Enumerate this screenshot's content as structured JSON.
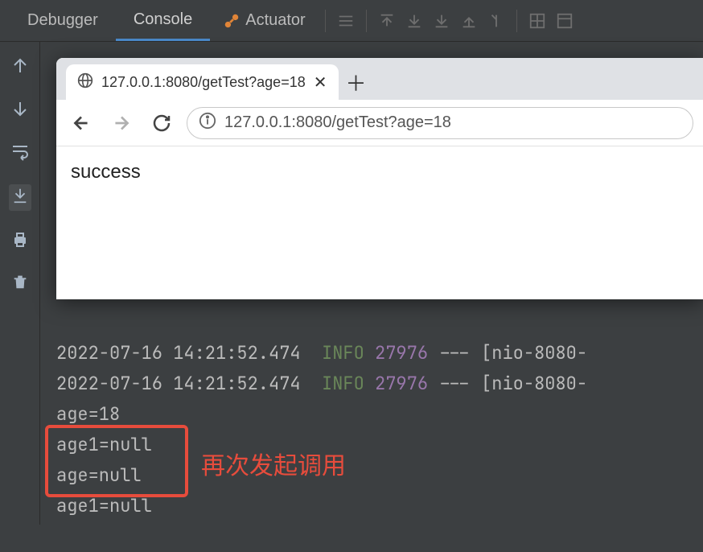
{
  "ideTabs": {
    "debugger": "Debugger",
    "console": "Console",
    "actuator": "Actuator"
  },
  "browser": {
    "tabTitle": "127.0.0.1:8080/getTest?age=18",
    "addressUrl": "127.0.0.1:8080/getTest?age=18",
    "pageContent": "success"
  },
  "console": {
    "lines": [
      {
        "time": "2022-07-16 14:21:52.474",
        "level": "INFO",
        "pid": "27976",
        "sep": "---",
        "thread": "[nio-8080-"
      },
      {
        "time": "2022-07-16 14:21:52.474",
        "level": "INFO",
        "pid": "27976",
        "sep": "---",
        "thread": "[nio-8080-"
      }
    ],
    "plain": [
      "age=18",
      "age1=null",
      "age=null",
      "age1=null"
    ]
  },
  "annotation": "再次发起调用"
}
